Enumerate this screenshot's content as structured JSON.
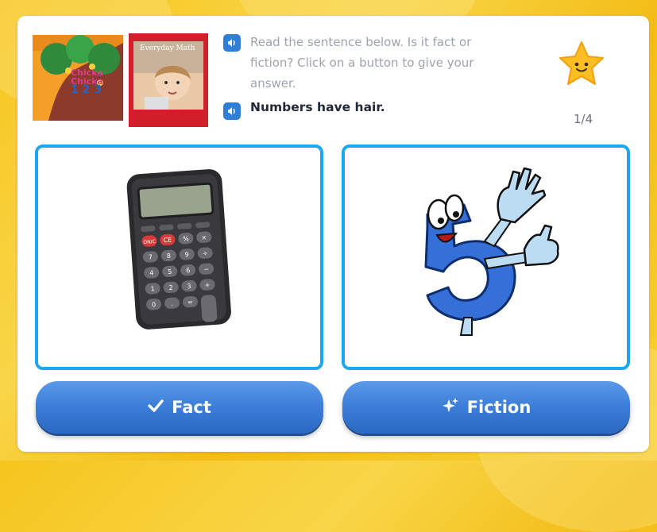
{
  "header": {
    "prompt": "Read the sentence below. Is it fact or fiction? Click on a button to give your answer.",
    "sentence": "Numbers have hair.",
    "progress": "1/4"
  },
  "book1": {
    "lines": [
      "Chicka",
      "Chicka",
      "1 2 3"
    ]
  },
  "book2": {
    "label": "Everyday Math"
  },
  "calculator": {
    "rows": [
      [
        "",
        "",
        "",
        ""
      ],
      [
        "ON/C",
        "CE",
        "%",
        "×"
      ],
      [
        "7",
        "8",
        "9",
        "÷"
      ],
      [
        "4",
        "5",
        "6",
        "−"
      ],
      [
        "1",
        "2",
        "3",
        "+"
      ],
      [
        "0",
        ".",
        "="
      ]
    ]
  },
  "buttons": {
    "fact_label": "Fact",
    "fiction_label": "Fiction"
  },
  "colors": {
    "accent": "#1ea7f0",
    "button": "#3b7dd8",
    "star": "#fbbf24"
  }
}
